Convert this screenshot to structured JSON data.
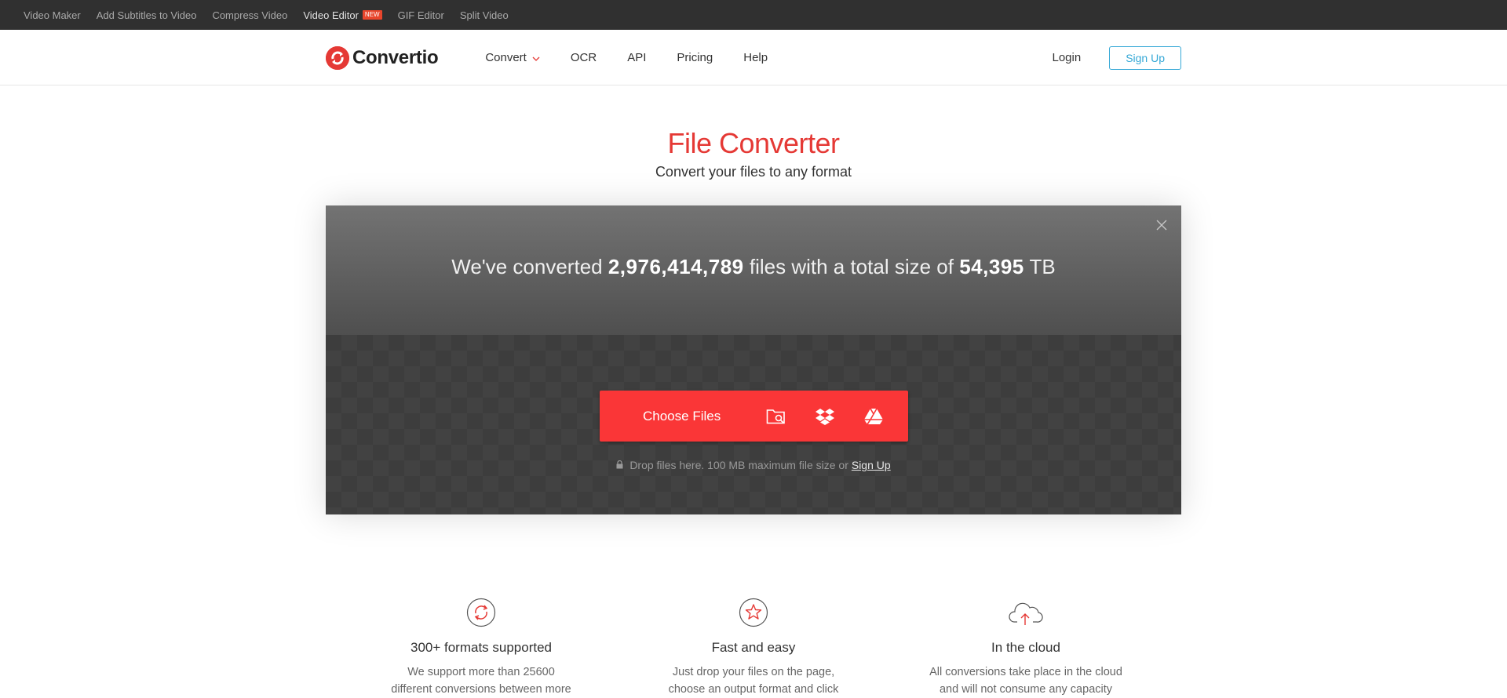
{
  "topbar": {
    "links": [
      {
        "label": "Video Maker"
      },
      {
        "label": "Add Subtitles to Video"
      },
      {
        "label": "Compress Video"
      },
      {
        "label": "Video Editor",
        "badge": "NEW"
      },
      {
        "label": "GIF Editor"
      },
      {
        "label": "Split Video"
      }
    ]
  },
  "header": {
    "logo_text": "Convertio",
    "nav": [
      {
        "label": "Convert",
        "icon": "chevron-down-icon"
      },
      {
        "label": "OCR"
      },
      {
        "label": "API"
      },
      {
        "label": "Pricing"
      },
      {
        "label": "Help"
      }
    ],
    "login": "Login",
    "signup": "Sign Up"
  },
  "hero": {
    "title": "File Converter",
    "subtitle": "Convert your files to any format"
  },
  "stats": {
    "prefix": "We've converted",
    "files": "2,976,414,789",
    "middle": "files with a total size of",
    "size": "54,395",
    "unit": "TB"
  },
  "upload": {
    "choose_label": "Choose Files",
    "sources": [
      "folder-search-icon",
      "dropbox-icon",
      "google-drive-icon"
    ],
    "hint": "Drop files here. 100 MB maximum file size or",
    "hint_link": "Sign Up"
  },
  "features": [
    {
      "icon": "sync-icon",
      "title": "300+ formats supported",
      "text_lines": [
        "We support more than 25600",
        "different conversions between more"
      ]
    },
    {
      "icon": "star-icon",
      "title": "Fast and easy",
      "text_lines": [
        "Just drop your files on the page,",
        "choose an output format and click"
      ]
    },
    {
      "icon": "cloud-upload-icon",
      "title": "In the cloud",
      "text_lines": [
        "All conversions take place in the cloud",
        "and will not consume any capacity"
      ]
    }
  ],
  "colors": {
    "brand_red": "#e53935",
    "button_red": "#fa3637",
    "signup_blue": "#35a8d6",
    "topbar_bg": "#303030"
  }
}
